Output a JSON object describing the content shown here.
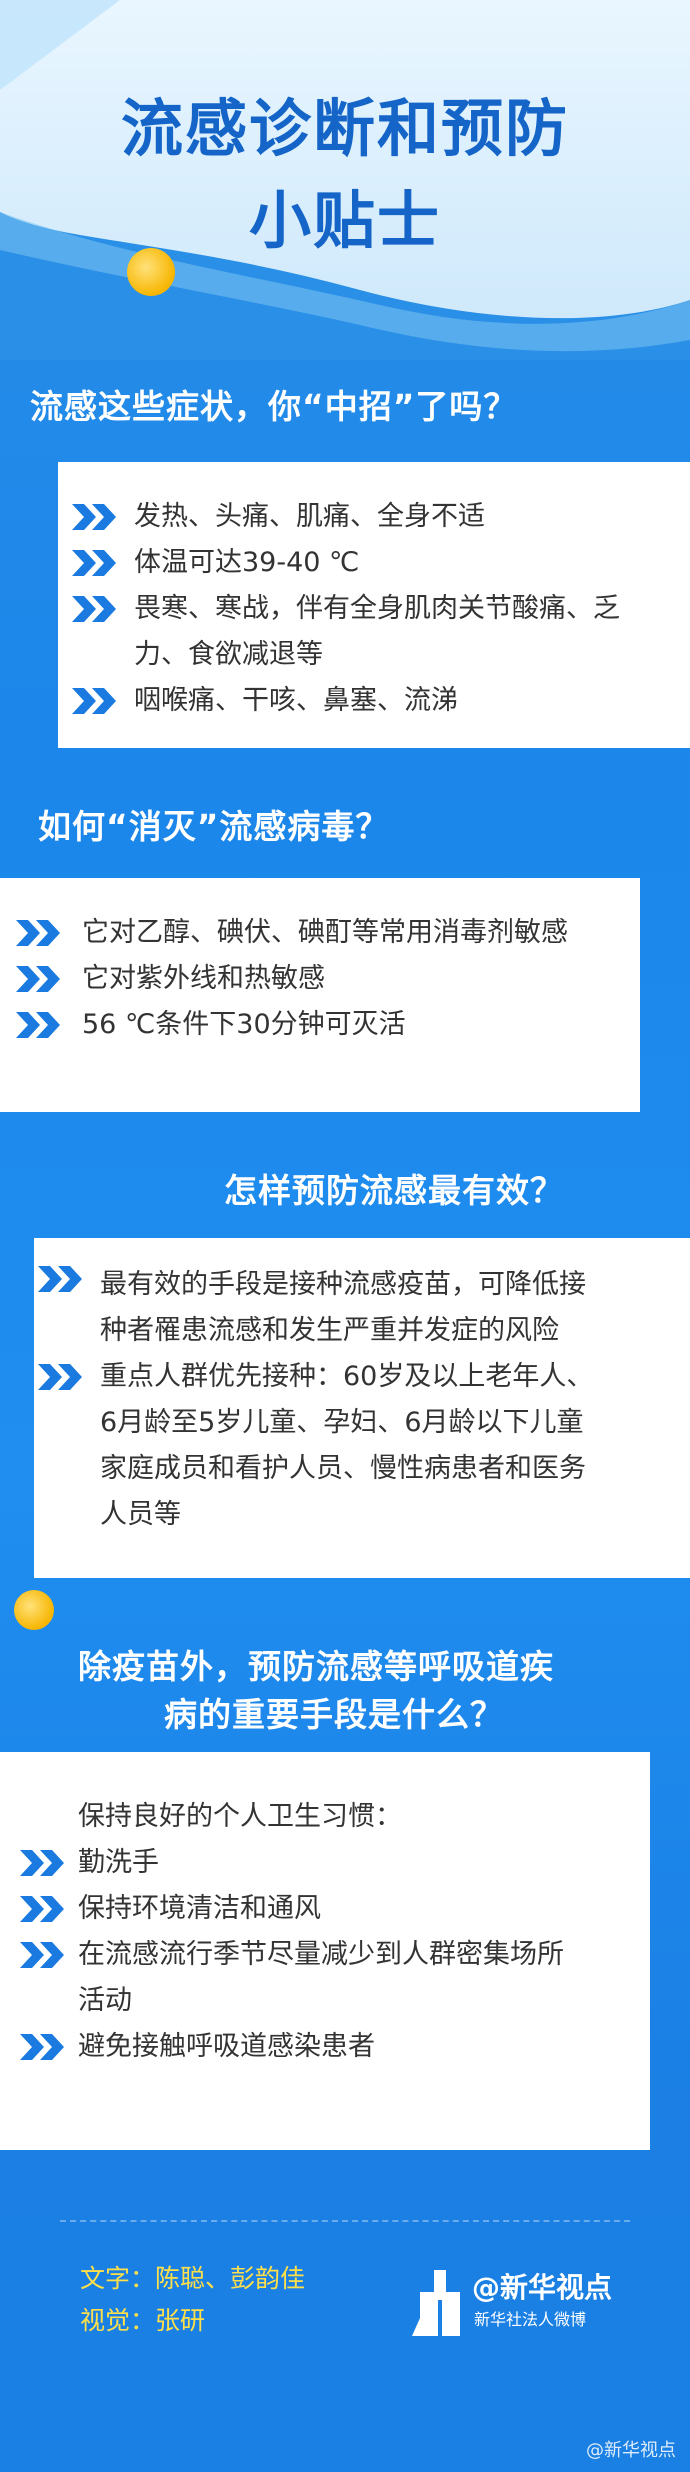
{
  "header": {
    "title_line1": "流感诊断和预防",
    "title_line2": "小贴士"
  },
  "sections": [
    {
      "title": "流感这些症状，你“中招”了吗？",
      "items": [
        "发热、头痛、肌痛、全身不适",
        "体温可达39-40 ℃",
        "畏寒、寒战，伴有全身肌肉关节酸痛、乏",
        "力、食欲减退等",
        "咽喉痛、干咳、鼻塞、流涕"
      ]
    },
    {
      "title": "如何“消灭”流感病毒？",
      "items": [
        "它对乙醇、碘伏、碘酊等常用消毒剂敏感",
        "它对紫外线和热敏感",
        "56 ℃条件下30分钟可灭活"
      ]
    },
    {
      "title": "怎样预防流感最有效？",
      "items": [
        "最有效的手段是接种流感疫苗，可降低接",
        "种者罹患流感和发生严重并发症的风险",
        "重点人群优先接种：60岁及以上老年人、",
        "6月龄至5岁儿童、孕妇、6月龄以下儿童",
        "家庭成员和看护人员、慢性病患者和医务",
        "人员等"
      ]
    },
    {
      "title_line1": "除疫苗外，预防流感等呼吸道疾",
      "title_line2": "病的重要手段是什么？",
      "items": [
        "保持良好的个人卫生习惯：",
        "勤洗手",
        "保持环境清洁和通风",
        "在流感流行季节尽量减少到人群密集场所",
        "活动",
        "避免接触呼吸道感染患者"
      ]
    }
  ],
  "credits": {
    "text_line": "文字：陈聪、彭韵佳",
    "visual_line": "视觉：张研"
  },
  "logo": {
    "brand": "@新华视点",
    "sub": "新华社法人微博"
  },
  "watermark": "@新华视点",
  "colors": {
    "background": "#1c86ea",
    "title": "#1565c8",
    "chevron": "#1a7ae0",
    "credits": "#ffe04a"
  }
}
